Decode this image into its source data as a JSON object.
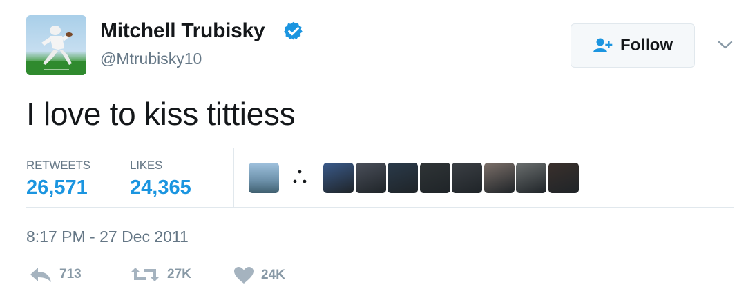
{
  "tweet": {
    "user": {
      "name": "Mitchell Trubisky",
      "handle": "@Mtrubisky10",
      "verified": true,
      "avatar": "football-player-avatar"
    },
    "follow_label": "Follow",
    "text": "I love to kiss tittiess",
    "stats": {
      "retweets_label": "RETWEETS",
      "retweets_value": "26,571",
      "likes_label": "LIKES",
      "likes_value": "24,365"
    },
    "timestamp": "8:17 PM - 27 Dec 2011",
    "actions": {
      "reply_count": "713",
      "retweet_count": "27K",
      "like_count": "24K"
    },
    "likers": [
      {
        "name": "liker-avatar-1",
        "color": "#6d8fb0"
      },
      {
        "name": "liker-avatar-2",
        "color": "#3a5a8a"
      },
      {
        "name": "liker-avatar-3",
        "color": "#4a4f5a"
      },
      {
        "name": "liker-avatar-4",
        "color": "#2a3a4a"
      },
      {
        "name": "liker-avatar-5",
        "color": "#2f3436"
      },
      {
        "name": "liker-avatar-6",
        "color": "#3b3f44"
      },
      {
        "name": "liker-avatar-7",
        "color": "#7b6f69"
      },
      {
        "name": "liker-avatar-8",
        "color": "#6a6e6e"
      },
      {
        "name": "liker-avatar-9",
        "color": "#3a302c"
      }
    ]
  },
  "colors": {
    "accent": "#1b95e0",
    "text": "#14171a",
    "muted": "#657786",
    "action": "#8899a6",
    "divider": "#e1e8ed"
  }
}
